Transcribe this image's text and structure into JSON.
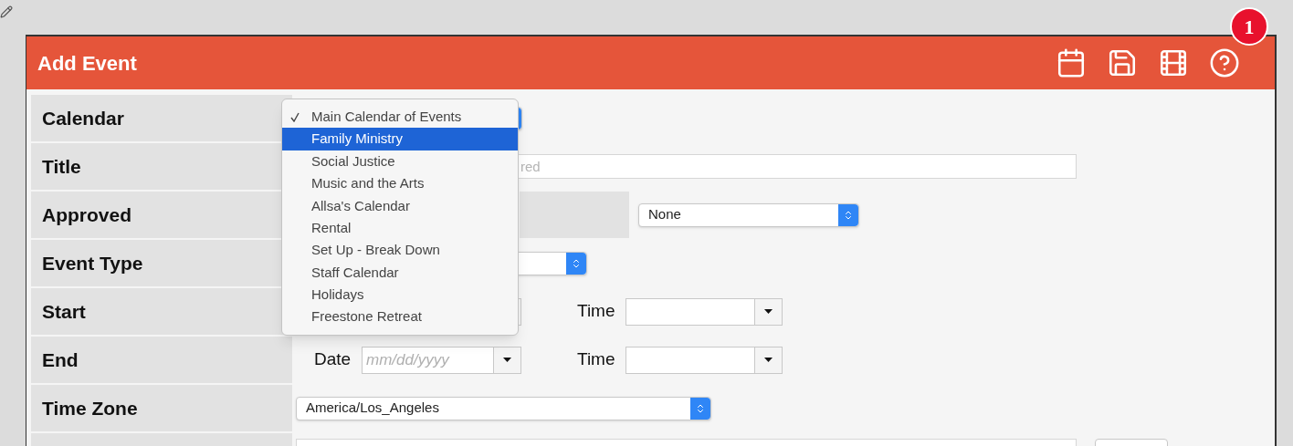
{
  "panel": {
    "title": "Add Event"
  },
  "badge": "1",
  "rows": [
    {
      "label": "Calendar",
      "kind": "calendar"
    },
    {
      "label": "Title",
      "kind": "title",
      "placeholder": "red"
    },
    {
      "label": "Approved",
      "kind": "approved",
      "value": "None"
    },
    {
      "label": "Event Type",
      "kind": "select"
    },
    {
      "label": "Start",
      "kind": "datetime",
      "time_label": "Time"
    },
    {
      "label": "End",
      "kind": "datetime",
      "date_label": "Date",
      "date_placeholder": "mm/dd/yyyy",
      "time_label": "Time"
    },
    {
      "label": "Time Zone",
      "kind": "timezone",
      "value": "America/Los_Angeles"
    },
    {
      "kind": "partial"
    }
  ],
  "dropdown": {
    "items": [
      {
        "label": "Main Calendar of Events",
        "checked": true,
        "selected": false
      },
      {
        "label": "Family Ministry",
        "checked": false,
        "selected": true
      },
      {
        "label": "Social Justice",
        "checked": false,
        "selected": false
      },
      {
        "label": "Music and the Arts",
        "checked": false,
        "selected": false
      },
      {
        "label": "Allsa's Calendar",
        "checked": false,
        "selected": false
      },
      {
        "label": "Rental",
        "checked": false,
        "selected": false
      },
      {
        "label": "Set Up - Break Down",
        "checked": false,
        "selected": false
      },
      {
        "label": "Staff Calendar",
        "checked": false,
        "selected": false
      },
      {
        "label": "Holidays",
        "checked": false,
        "selected": false
      },
      {
        "label": "Freestone Retreat",
        "checked": false,
        "selected": false
      }
    ]
  }
}
